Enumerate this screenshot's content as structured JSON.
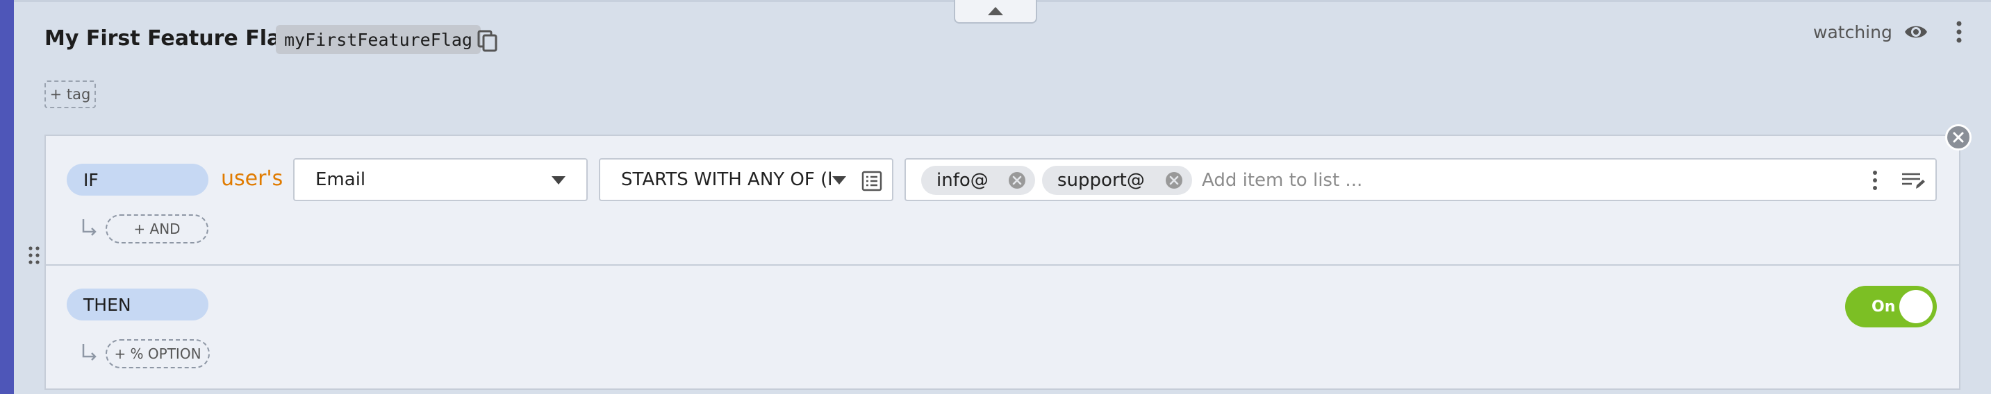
{
  "flag": {
    "title": "My First Feature Flag",
    "key": "myFirstFeatureFlag",
    "watching_label": "watching",
    "add_tag_label": "+ tag"
  },
  "icons": {
    "copy": "copy-icon",
    "eye": "eye-icon",
    "more": "kebab-icon",
    "collapse": "chevron-up-icon",
    "remove_rule": "close-icon",
    "drag": "drag-handle-icon",
    "list": "list-icon",
    "edit_list": "edit-list-icon",
    "chip_remove": "close-circle-icon",
    "subitem": "corner-arrow-icon"
  },
  "rule": {
    "if_label": "IF",
    "subject_label": "user's",
    "attribute": "Email",
    "comparator": "STARTS WITH ANY OF (hashed)",
    "values": [
      "info@",
      "support@"
    ],
    "add_item_placeholder": "Add item to list ...",
    "and_label": "+ AND",
    "then_label": "THEN",
    "option_label": "+ % OPTION",
    "toggle_label": "On",
    "toggle_on": true
  },
  "colors": {
    "accent_bar": "#4e56b8",
    "subject_text": "#e07b00",
    "pill": "#c6d8f3",
    "toggle_on": "#7cbf24"
  }
}
